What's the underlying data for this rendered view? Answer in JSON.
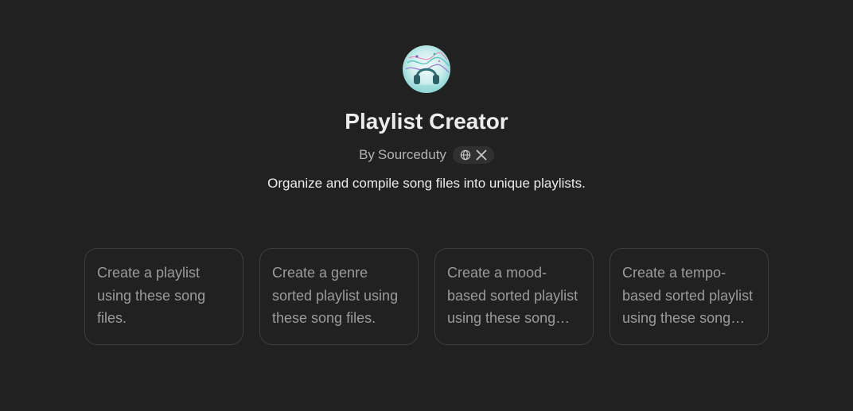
{
  "gpt": {
    "title": "Playlist Creator",
    "author_prefix": "By",
    "author": "Sourceduty",
    "description": "Organize and compile song files into unique playlists.",
    "avatar_icon": "headphones-music-icon",
    "social_icons": [
      "globe-icon",
      "x-logo-icon"
    ]
  },
  "prompts": [
    {
      "text": "Create a playlist using these song files."
    },
    {
      "text": "Create a genre sorted playlist using these song files."
    },
    {
      "text": "Create a mood-based sorted playlist using these song files."
    },
    {
      "text": "Create a tempo-based sorted playlist using these song files."
    }
  ],
  "colors": {
    "background": "#212121",
    "title": "#ececec",
    "muted": "#b4b4b4",
    "card_border": "#3d3d3d",
    "card_text": "#9b9b9b"
  }
}
